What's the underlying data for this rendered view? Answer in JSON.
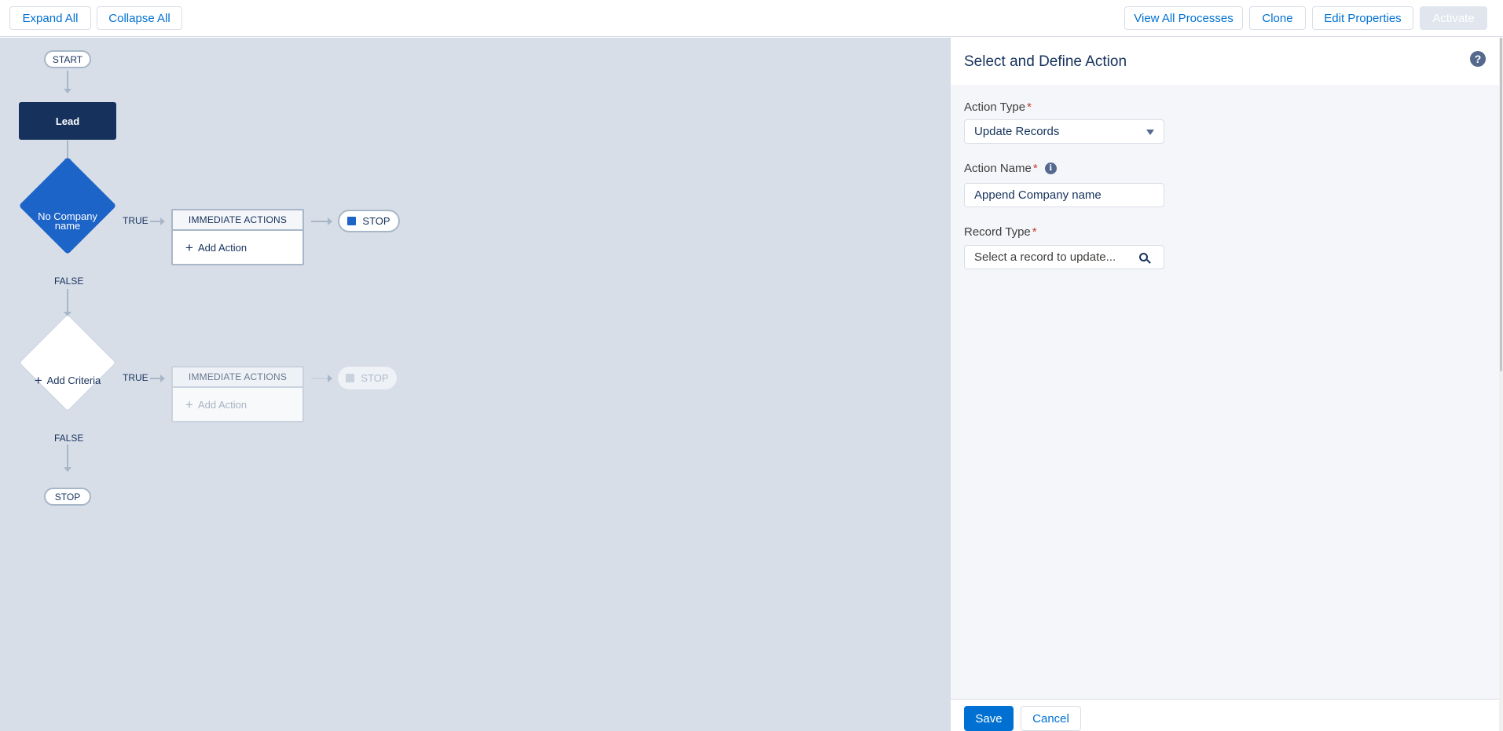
{
  "toolbar": {
    "expand_all": "Expand All",
    "collapse_all": "Collapse All",
    "view_all_processes": "View All Processes",
    "clone": "Clone",
    "edit_properties": "Edit Properties",
    "activate": "Activate"
  },
  "canvas": {
    "start": "START",
    "object_node": "Lead",
    "criteria1": {
      "label_line1": "No Company",
      "label_line2": "name",
      "true_label": "TRUE",
      "false_label": "FALSE"
    },
    "criteria2": {
      "label": "Add Criteria",
      "true_label": "TRUE",
      "false_label": "FALSE"
    },
    "immediate_actions_1": {
      "header": "IMMEDIATE ACTIONS",
      "add_action": "Add Action"
    },
    "immediate_actions_2": {
      "header": "IMMEDIATE ACTIONS",
      "add_action": "Add Action"
    },
    "stop_1": "STOP",
    "stop_2": "STOP",
    "stop_end": "STOP"
  },
  "panel": {
    "title": "Select and Define Action",
    "action_type": {
      "label": "Action Type",
      "value": "Update Records"
    },
    "action_name": {
      "label": "Action Name",
      "value": "Append Company name"
    },
    "record_type": {
      "label": "Record Type",
      "placeholder": "Select a record to update..."
    },
    "required_marker": "*",
    "save": "Save",
    "cancel": "Cancel"
  },
  "colors": {
    "primary": "#0070d2",
    "navy": "#16325c",
    "criteria_blue": "#1d64c8",
    "canvas_bg": "#d8dee8"
  },
  "icons": [
    "help-icon",
    "info-icon",
    "search-icon",
    "plus-icon",
    "stop-icon",
    "caret-down-icon"
  ]
}
